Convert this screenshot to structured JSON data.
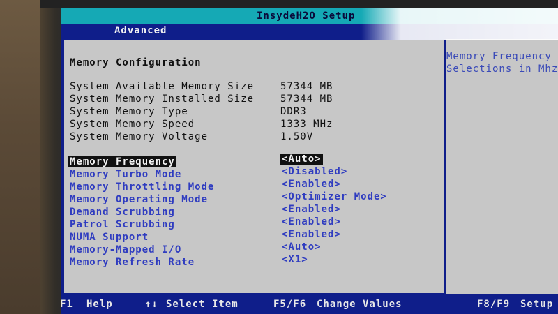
{
  "window": {
    "title": "InsydeH2O Setup"
  },
  "tabs": {
    "active": "Advanced"
  },
  "main": {
    "section_title": "Memory Configuration",
    "info": [
      {
        "label": "System Available Memory Size",
        "value": "57344 MB"
      },
      {
        "label": "System Memory Installed Size",
        "value": "57344 MB"
      },
      {
        "label": "System Memory Type",
        "value": "DDR3"
      },
      {
        "label": "System Memory Speed",
        "value": "1333 MHz"
      },
      {
        "label": "System Memory Voltage",
        "value": "1.50V"
      }
    ],
    "options": [
      {
        "label": "Memory Frequency",
        "value": "<Auto>",
        "selected": true
      },
      {
        "label": "Memory Turbo Mode",
        "value": "<Disabled>"
      },
      {
        "label": "Memory Throttling Mode",
        "value": "<Enabled>"
      },
      {
        "label": "Memory Operating Mode",
        "value": "<Optimizer Mode>"
      },
      {
        "label": "Demand Scrubbing",
        "value": "<Enabled>"
      },
      {
        "label": "Patrol Scrubbing",
        "value": "<Enabled>"
      },
      {
        "label": "NUMA Support",
        "value": "<Enabled>"
      },
      {
        "label": "Memory-Mapped I/O",
        "value": "<Auto>"
      },
      {
        "label": "Memory Refresh Rate",
        "value": "<X1>"
      }
    ]
  },
  "help": {
    "text_line1": "Memory Frequency",
    "text_line2": "Selections in Mhz"
  },
  "footer": {
    "f1_key": "F1",
    "f1_label": "Help",
    "arrows_key": "↑↓",
    "arrows_label": "Select Item",
    "f5f6_key": "F5/F6",
    "f5f6_label": "Change Values",
    "f8f9_key": "F8/F9",
    "f8f9_label": "Setup"
  },
  "colors": {
    "screen_bg": "#0f1e8a",
    "panel_bg": "#c7c7c7",
    "title_bar": "#15a9b5",
    "option_text": "#2f3cc0"
  }
}
